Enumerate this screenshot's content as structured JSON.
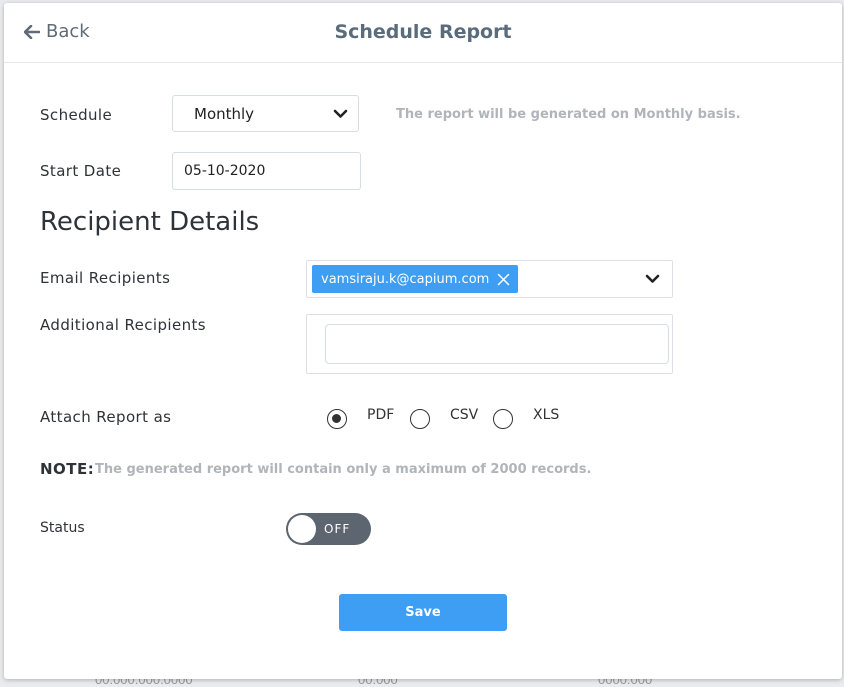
{
  "backdrop": {
    "fragments": [
      "00.000.000.0000",
      "00.000",
      "0000.000"
    ]
  },
  "header": {
    "back_label": "Back",
    "title": "Schedule Report"
  },
  "schedule": {
    "label": "Schedule",
    "value": "Monthly",
    "hint": "The report will be generated on Monthly basis."
  },
  "start_date": {
    "label": "Start Date",
    "value": "05-10-2020"
  },
  "recipients": {
    "section_title": "Recipient Details",
    "email_label": "Email Recipients",
    "email_chips": [
      "vamsiraju.k@capium.com"
    ],
    "additional_label": "Additional Recipients",
    "additional_value": ""
  },
  "attach": {
    "label": "Attach Report as",
    "options": [
      "PDF",
      "CSV",
      "XLS"
    ],
    "selected": "PDF"
  },
  "note": {
    "label": "NOTE:",
    "text": "The generated report will contain only a maximum of 2000 records."
  },
  "status": {
    "label": "Status",
    "toggle_text": "OFF"
  },
  "footer": {
    "save_label": "Save"
  },
  "colors": {
    "accent": "#3d9ef3",
    "toggle_off": "#5c6570",
    "hint": "#b0b5ba"
  }
}
